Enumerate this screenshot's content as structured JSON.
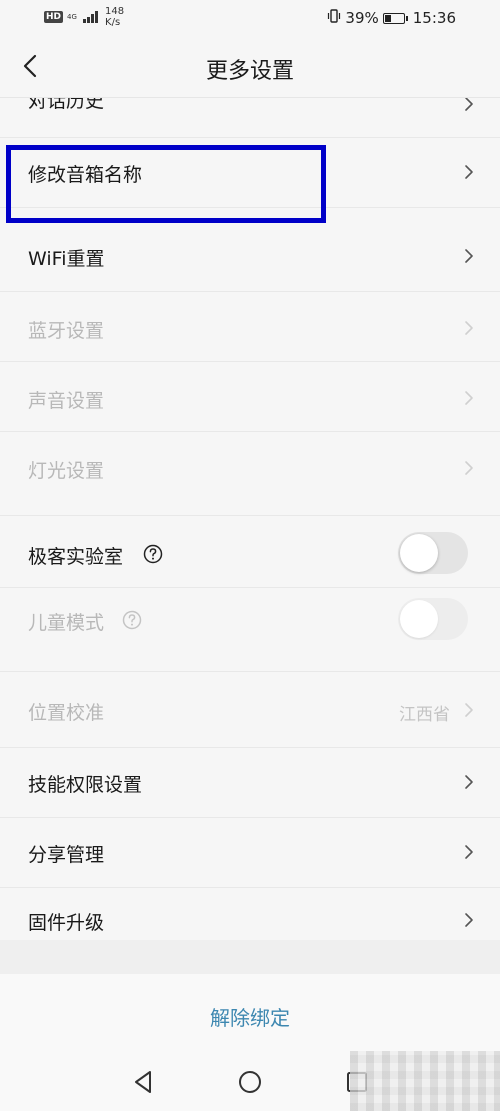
{
  "status_bar": {
    "hd": "HD",
    "network": "4G",
    "speed_value": "148",
    "speed_unit": "K/s",
    "battery": "39%",
    "battery_level": 0.39,
    "time": "15:36"
  },
  "header": {
    "title": "更多设置"
  },
  "rows": {
    "chat_history": "对话历史",
    "rename_speaker": "修改音箱名称",
    "wifi_reset": "WiFi重置",
    "bluetooth": "蓝牙设置",
    "sound": "声音设置",
    "light": "灯光设置",
    "geek_lab": "极客实验室",
    "kids_mode": "儿童模式",
    "location": "位置校准",
    "location_value": "江西省",
    "skill_permission": "技能权限设置",
    "share_manage": "分享管理",
    "firmware": "固件升级"
  },
  "unbind": {
    "label": "解除绑定"
  },
  "colors": {
    "highlight": "#0000c8",
    "link": "#3d87b0"
  },
  "icons": {
    "back": "chevron-left-icon",
    "chevron": "chevron-right-icon",
    "help": "question-circle-icon",
    "nav_back": "triangle-back-icon",
    "nav_home": "circle-home-icon",
    "nav_recent": "square-recent-icon"
  }
}
